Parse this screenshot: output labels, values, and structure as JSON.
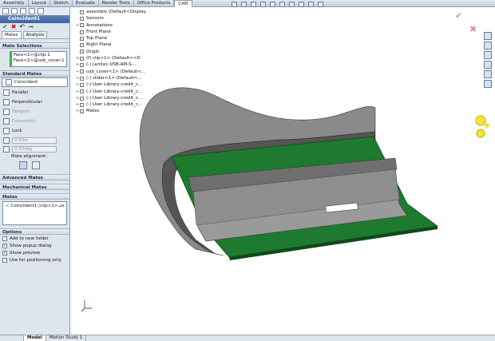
{
  "command_tabs": [
    "Assembly",
    "Layout",
    "Sketch",
    "Evaluate",
    "Render Tools",
    "Office Products",
    "CAM"
  ],
  "feature_title": "Coincident1",
  "panel_tabs": [
    "Mates",
    "Analysis"
  ],
  "sections": {
    "mate_selections": "Mate Selections",
    "standard_mates": "Standard Mates",
    "advanced_mates": "Advanced Mates",
    "mechanical_mates": "Mechanical Mates",
    "mates": "Mates",
    "options": "Options"
  },
  "selections": [
    "Face<1>@clip-1",
    "Face<2>@usb_cover-1"
  ],
  "standard": [
    "Coincident",
    "Parallel",
    "Perpendicular",
    "Tangent",
    "Concentric",
    "Lock"
  ],
  "distance": "0.00in",
  "angle": "0.00deg",
  "mate_alignment": "Mate alignment:",
  "mates_list": [
    "Coincident1 (clip<1>,us"
  ],
  "options": [
    {
      "label": "Add to new folder",
      "checked": false
    },
    {
      "label": "Show popup dialog",
      "checked": true
    },
    {
      "label": "Show preview",
      "checked": true
    },
    {
      "label": "Use for positioning only",
      "checked": false
    }
  ],
  "tree": [
    "assembly  (Default<Display",
    "Sensors",
    "Annotations",
    "Front Plane",
    "Top Plane",
    "Right Plane",
    "Origin",
    "(f) clip<1> (Default<<D",
    "(-) [amtec-USB-AM-S-...",
    "usb_cover<1> (Default<...",
    "(-) slider<1> (Default<...",
    "(-) User Library-credit_c...",
    "(-) User Library-credit_c...",
    "(-) User Library-credit_c...",
    "(-) User Library-credit_c...",
    "Mates"
  ],
  "bottom_tabs": [
    "Model",
    "Motion Study 1"
  ],
  "colors": {
    "accent": "#3c64a0",
    "pcb": "#1e7a2e",
    "shell": "#7d7d7d"
  }
}
